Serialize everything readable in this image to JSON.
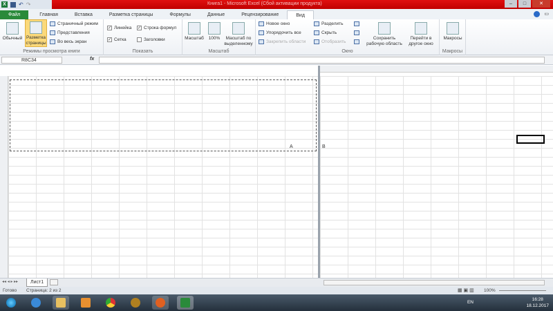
{
  "window": {
    "title": "Книга1 - Microsoft Excel (Сбой активации продукта)",
    "app_icon": "X"
  },
  "tabs": [
    "Файл",
    "Главная",
    "Вставка",
    "Разметка страницы",
    "Формулы",
    "Данные",
    "Рецензирование",
    "Вид"
  ],
  "ribbon": {
    "views": {
      "label": "Режимы просмотра книги",
      "normal": "Обычный",
      "page_layout": "Разметка страницы",
      "page_break": "Страничный режим",
      "custom_views": "Представления",
      "full_screen": "Во весь экран"
    },
    "show": {
      "label": "Показать",
      "ruler": "Линейка",
      "formula_bar": "Строка формул",
      "gridlines": "Сетка",
      "headings": "Заголовки",
      "ruler_checked": true,
      "formula_checked": true,
      "grid_checked": true,
      "headings_checked": false
    },
    "zoom": {
      "label": "Масштаб",
      "zoom": "Масштаб",
      "hundred": "100%",
      "zoom_selection": "Масштаб по выделенному"
    },
    "window": {
      "label": "Окно",
      "new_window": "Новое окно",
      "arrange_all": "Упорядочить все",
      "freeze": "Закрепить области",
      "split": "Разделить",
      "hide": "Скрыть",
      "unhide": "Отобразить",
      "save_workspace": "Сохранить рабочую область",
      "switch_windows": "Перейти в другое окно"
    },
    "macros": {
      "label": "Макросы",
      "macros": "Макросы"
    }
  },
  "formula_bar": {
    "name_box": "R8C34",
    "fx": "fx",
    "value": ""
  },
  "pages": {
    "a": "A",
    "b": "B"
  },
  "sheets": [
    "Лист1"
  ],
  "status": {
    "ready": "Готово",
    "page": "Страница: 2 из 2",
    "zoom": "100%"
  },
  "taskbar": {
    "lang": "EN",
    "time": "16:28",
    "date": "18.12.2017"
  }
}
